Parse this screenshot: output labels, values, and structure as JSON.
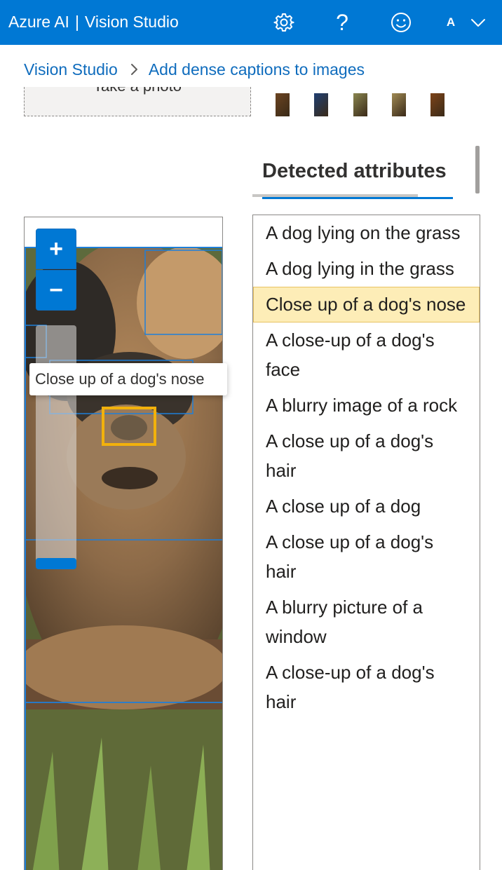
{
  "header": {
    "brand_primary": "Azure AI",
    "brand_separator": "|",
    "brand_secondary": "Vision Studio",
    "settings_icon": "gear-icon",
    "help_label": "?",
    "feedback_icon": "smiley-icon",
    "user_initial": "A",
    "user_menu_icon": "chevron-down-icon"
  },
  "breadcrumb": {
    "items": [
      "Vision Studio",
      "Add dense captions to images"
    ],
    "separator_icon": "chevron-right-icon"
  },
  "upload": {
    "take_photo_label": "Take a photo"
  },
  "sample_thumbnails": [
    "#6b4421",
    "#1f3f72",
    "#8a8650",
    "#a08a54",
    "#7d4419"
  ],
  "tabs": {
    "active_label": "Detected attributes"
  },
  "viewer": {
    "zoom_in_label": "+",
    "zoom_out_label": "−",
    "zoom_level": 0.98,
    "tooltip": "Close up of a dog's nose"
  },
  "captions": [
    "A dog lying on the grass",
    "A dog lying in the grass",
    "Close up of a dog's nose",
    "A close-up of a dog's face",
    "A blurry image of a rock",
    "A close up of a dog's hair",
    "A close up of a dog",
    "A close up of a dog's hair",
    "A blurry picture of a window",
    "A close-up of a dog's hair"
  ],
  "selected_caption_index": 2,
  "colors": {
    "brand_blue": "#0078d4",
    "selected_highlight": "#fdedb7",
    "selected_box": "#f2b10c",
    "region_box": "#1e7fd9"
  }
}
